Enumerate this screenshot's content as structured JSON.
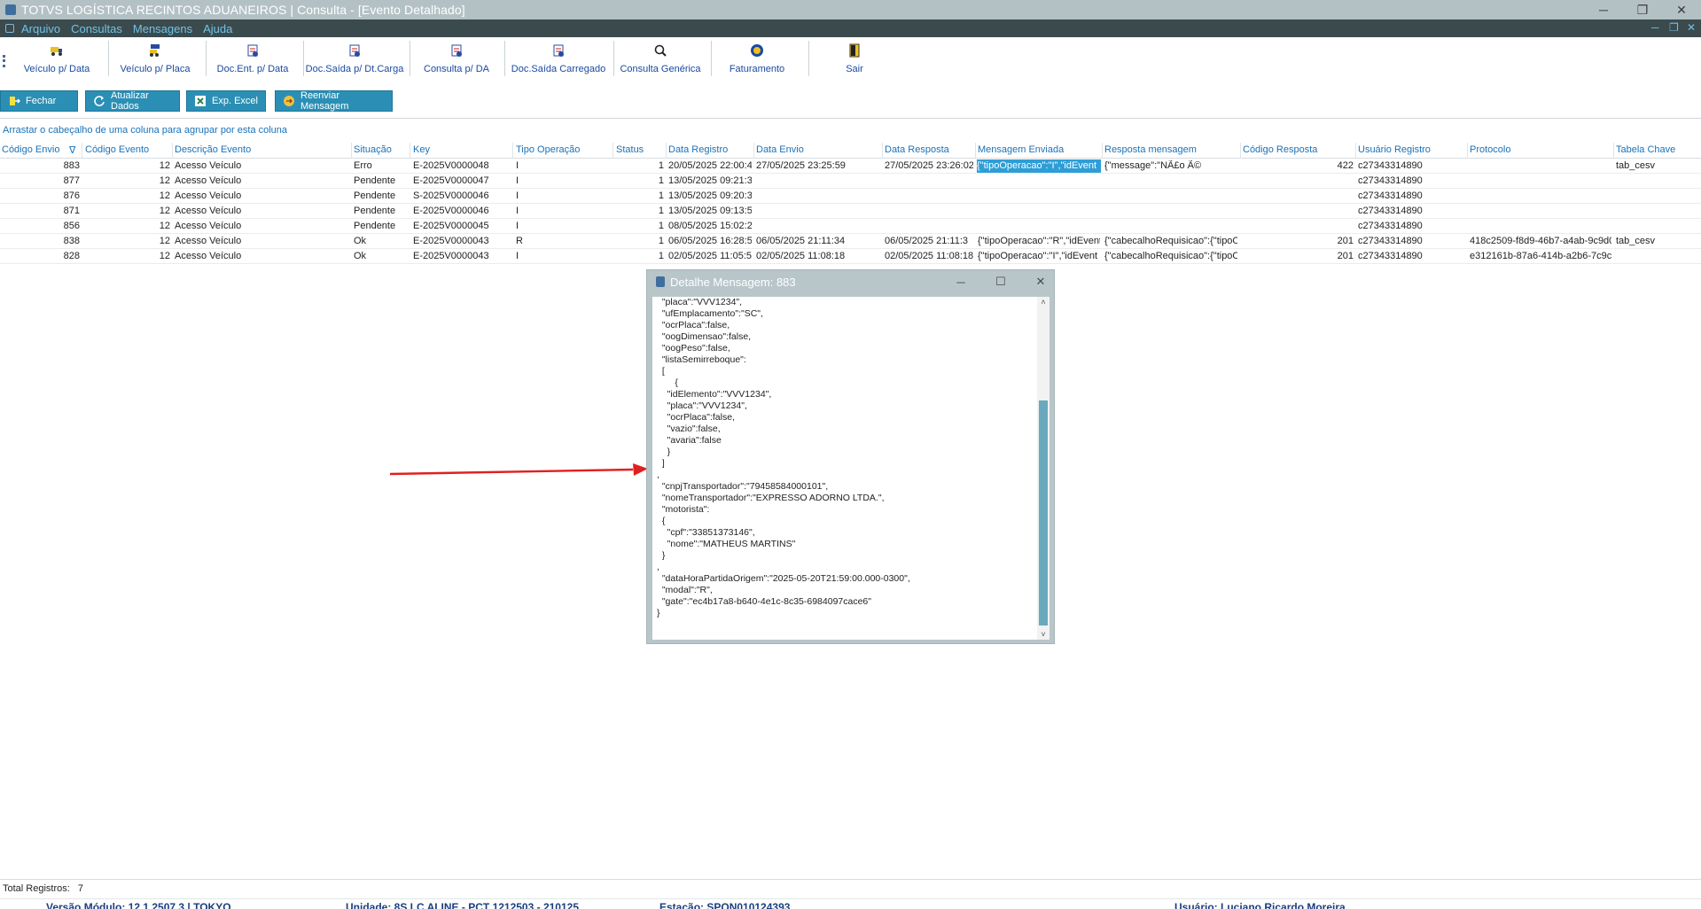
{
  "window": {
    "title": "TOTVS LOGÍSTICA RECINTOS ADUANEIROS | Consulta - [Evento Detalhado]",
    "minimize": "─",
    "restore": "❐",
    "close": "✕"
  },
  "menu": {
    "items": [
      "Arquivo",
      "Consultas",
      "Mensagens",
      "Ajuda"
    ],
    "mdi_minimize": "─",
    "mdi_restore": "❐",
    "mdi_close": "✕"
  },
  "toolbar": {
    "items": [
      {
        "label": "Veículo p/ Data",
        "icon": "truck-icon"
      },
      {
        "label": "Veículo p/ Placa",
        "icon": "vehicle-plate-icon"
      },
      {
        "label": "Doc.Ent. p/ Data",
        "icon": "document-in-icon"
      },
      {
        "label": "Doc.Saída p/ Dt.Carga",
        "icon": "document-out-icon"
      },
      {
        "label": "Consulta p/ DA",
        "icon": "document-da-icon"
      },
      {
        "label": "Doc.Saída Carregado",
        "icon": "document-loaded-icon"
      },
      {
        "label": "Consulta Genérica",
        "icon": "magnifier-icon"
      },
      {
        "label": "Faturamento",
        "icon": "coin-icon"
      },
      {
        "label": "Sair",
        "icon": "exit-door-icon"
      }
    ]
  },
  "actions": {
    "close": "Fechar",
    "refresh": "Atualizar Dados",
    "export": "Exp. Excel",
    "resend": "Reenviar Mensagem"
  },
  "grid": {
    "group_hint": "Arrastar o cabeçalho de uma coluna para agrupar por esta coluna",
    "sort_indicator": "∇",
    "columns": [
      "Código Envio",
      "Código Evento",
      "Descrição Evento",
      "Situação",
      "Key",
      "Tipo Operação",
      "Status",
      "Data Registro",
      "Data Envio",
      "Data Resposta",
      "Mensagem Enviada",
      "Resposta mensagem",
      "Código Resposta",
      "Usuário Registro",
      "Protocolo",
      "Tabela Chave"
    ],
    "rows": [
      [
        "883",
        "12",
        "Acesso Veículo",
        "Erro",
        "E-2025V0000048",
        "I",
        "1",
        "20/05/2025 22:00:4",
        "27/05/2025 23:25:59",
        "27/05/2025 23:26:02",
        "{\"tipoOperacao\":\"I\",\"idEvent",
        "{\"message\":\"NÃ£o Ã©",
        "422",
        "c27343314890",
        "",
        "tab_cesv"
      ],
      [
        "877",
        "12",
        "Acesso Veículo",
        "Pendente",
        "E-2025V0000047",
        "I",
        "1",
        "13/05/2025 09:21:3",
        "",
        "",
        "",
        "",
        "",
        "c27343314890",
        "",
        ""
      ],
      [
        "876",
        "12",
        "Acesso Veículo",
        "Pendente",
        "S-2025V0000046",
        "I",
        "1",
        "13/05/2025 09:20:3",
        "",
        "",
        "",
        "",
        "",
        "c27343314890",
        "",
        ""
      ],
      [
        "871",
        "12",
        "Acesso Veículo",
        "Pendente",
        "E-2025V0000046",
        "I",
        "1",
        "13/05/2025 09:13:5",
        "",
        "",
        "",
        "",
        "",
        "c27343314890",
        "",
        ""
      ],
      [
        "856",
        "12",
        "Acesso Veículo",
        "Pendente",
        "E-2025V0000045",
        "I",
        "1",
        "08/05/2025 15:02:2",
        "",
        "",
        "",
        "",
        "",
        "c27343314890",
        "",
        ""
      ],
      [
        "838",
        "12",
        "Acesso Veículo",
        "Ok",
        "E-2025V0000043",
        "R",
        "1",
        "06/05/2025 16:28:5",
        "06/05/2025 21:11:34",
        "06/05/2025 21:11:3",
        "{\"tipoOperacao\":\"R\",\"idEvent",
        "{\"cabecalhoRequisicao\":{\"tipoO",
        "201",
        "c27343314890",
        "418c2509-f8d9-46b7-a4ab-9c9d0",
        "tab_cesv"
      ],
      [
        "828",
        "12",
        "Acesso Veículo",
        "Ok",
        "E-2025V0000043",
        "I",
        "1",
        "02/05/2025 11:05:5",
        "02/05/2025 11:08:18",
        "02/05/2025 11:08:18",
        "{\"tipoOperacao\":\"I\",\"idEvent",
        "{\"cabecalhoRequisicao\":{\"tipoO",
        "201",
        "c27343314890",
        "e312161b-87a6-414b-a2b6-7c9c1",
        ""
      ]
    ]
  },
  "dialog": {
    "title": "Detalhe Mensagem:  883",
    "minimize": "─",
    "maximize": "☐",
    "close": "✕",
    "scroll_up": "˄",
    "scroll_down": "˅",
    "content": "  \"placa\":\"VVV1234\",\n  \"ufEmplacamento\":\"SC\",\n  \"ocrPlaca\":false,\n  \"oogDimensao\":false,\n  \"oogPeso\":false,\n  \"listaSemirreboque\":\n  [\n       {\n    \"idElemento\":\"VVV1234\",\n    \"placa\":\"VVV1234\",\n    \"ocrPlaca\":false,\n    \"vazio\":false,\n    \"avaria\":false\n    }\n  ]\n,\n  \"cnpjTransportador\":\"79458584000101\",\n  \"nomeTransportador\":\"EXPRESSO ADORNO LTDA.\",\n  \"motorista\":\n  {\n    \"cpf\":\"33851373146\",\n    \"nome\":\"MATHEUS MARTINS\"\n  }\n,\n  \"dataHoraPartidaOrigem\":\"2025-05-20T21:59:00.000-0300\",\n  \"modal\":\"R\",\n  \"gate\":\"ec4b17a8-b640-4e1c-8c35-6984097cace6\"\n}"
  },
  "status": {
    "total_label": "Total Registros:",
    "total_value": "7",
    "version": "Versão Módulo:  12.1.2507.3 | TOKYO",
    "unit": "Unidade: 8S LC ALINE - PCT 1212503 - 210125",
    "station": "Estação: SPON010124393",
    "user": "Usuário: Luciano Ricardo Moreira"
  },
  "colors": {
    "titlebar": "#b3c1c4",
    "menubar": "#3b4a4c",
    "accent": "#2b8fb5",
    "link": "#1a72b8",
    "selection": "#2e9ed6",
    "arrow": "#e02020"
  }
}
